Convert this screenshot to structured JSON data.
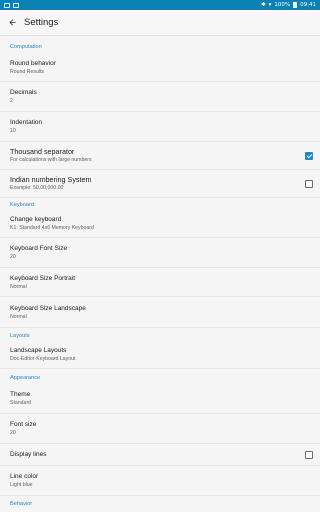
{
  "status_bar": {
    "battery": "100%",
    "time": "09:41"
  },
  "app_bar": {
    "title": "Settings"
  },
  "sections": {
    "computation": {
      "header": "Computation",
      "items": [
        {
          "title": "Round behavior",
          "summary": "Round Results"
        },
        {
          "title": "Decimals",
          "summary": "2"
        },
        {
          "title": "Indentation",
          "summary": "10"
        },
        {
          "title": "Thousand separator",
          "summary": "For calculations with large numbers",
          "checked": true
        },
        {
          "title": "Indian numbering System",
          "summary": "Example: 50,00,000.00",
          "checked": false
        }
      ]
    },
    "keyboard": {
      "header": "Keyboard",
      "items": [
        {
          "title": "Change keyboard",
          "summary": "K1: Standard 4x6 Memory Keyboard"
        },
        {
          "title": "Keyboard Font Size",
          "summary": "20"
        },
        {
          "title": "Keyboard Size Portrait",
          "summary": "Normal"
        },
        {
          "title": "Keyboard Size Landscape",
          "summary": "Normal"
        }
      ]
    },
    "layouts": {
      "header": "Layouts",
      "items": [
        {
          "title": "Landscape Layouts",
          "summary": "Doc-Editor-Keyboard Layout"
        }
      ]
    },
    "appearance": {
      "header": "Appearance",
      "items": [
        {
          "title": "Theme",
          "summary": "Standard"
        },
        {
          "title": "Font size",
          "summary": "20"
        },
        {
          "title": "Display lines",
          "checked": false
        },
        {
          "title": "Line color",
          "summary": "Light blue"
        }
      ]
    },
    "behavior": {
      "header": "Behavior"
    }
  },
  "colors": {
    "accent": "#1e88c9",
    "status_bar": "#0a82b4",
    "background": "#f5f5f5"
  },
  "icons": [
    "back-arrow-icon",
    "bluetooth-icon",
    "wifi-icon",
    "battery-icon"
  ]
}
